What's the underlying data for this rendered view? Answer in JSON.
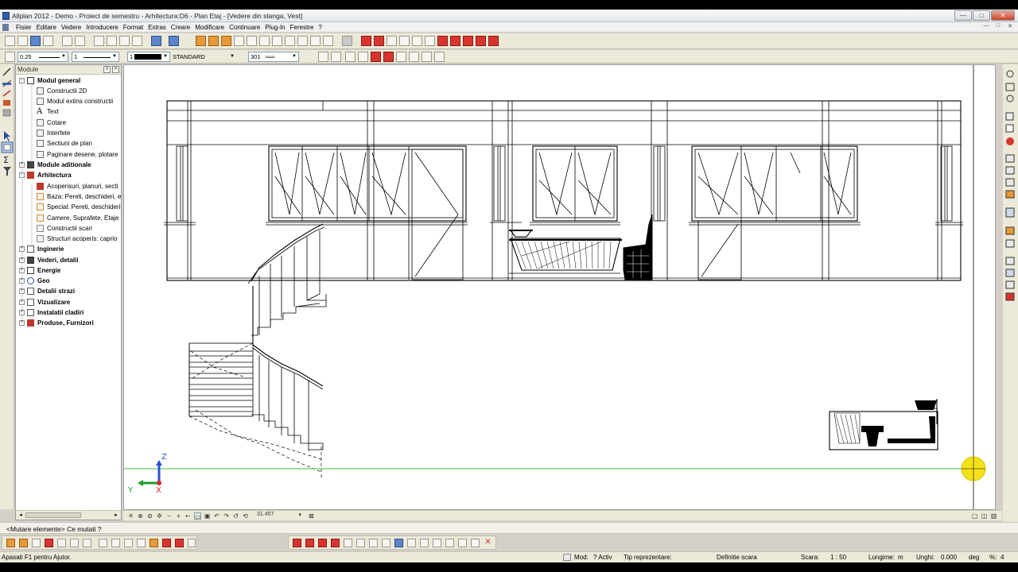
{
  "window": {
    "title": "Allplan 2012 - Demo - Proiect de semestru - Arhitectura:D6 - Plan Etaj - [Vedere din stanga, Vest]",
    "minimize": "—",
    "maximize": "□",
    "close": "✕"
  },
  "menu": {
    "items": [
      "Fisier",
      "Editare",
      "Vedere",
      "Introducere",
      "Format",
      "Extras",
      "Creare",
      "Modificare",
      "Continuare",
      "Plug-In",
      "Ferestre",
      "?"
    ],
    "mdi_min": "—",
    "mdi_restore": "□",
    "mdi_close": "✕"
  },
  "format_toolbar": {
    "pen_value": "0.25",
    "line_value": "1",
    "color_value": "1",
    "layer_value": "STANDARD",
    "hatch_value": "301"
  },
  "module_panel": {
    "title": "Module",
    "items": [
      {
        "label": "Modul general",
        "bold": true,
        "expander": "−",
        "icon": "module-general-icon"
      },
      {
        "label": "Constructii 2D",
        "bold": false,
        "icon": "construction-2d-icon"
      },
      {
        "label": "Modul extins constructii",
        "bold": false,
        "icon": "extended-construction-icon"
      },
      {
        "label": "Text",
        "bold": false,
        "icon": "text-icon",
        "glyph": "A"
      },
      {
        "label": "Cotare",
        "bold": false,
        "icon": "dimension-icon"
      },
      {
        "label": "Interfete",
        "bold": false,
        "icon": "interfaces-icon"
      },
      {
        "label": "Sectiuni de plan",
        "bold": false,
        "icon": "plan-section-icon"
      },
      {
        "label": "Paginare desene, plotare",
        "bold": false,
        "icon": "plot-layout-icon"
      },
      {
        "label": "Module aditionale",
        "bold": true,
        "expander": "+",
        "icon": "additional-modules-icon"
      },
      {
        "label": "Arhitectura",
        "bold": true,
        "expander": "−",
        "icon": "architecture-icon"
      },
      {
        "label": "Acoperisuri, planuri, secti",
        "bold": false,
        "icon": "roofs-icon"
      },
      {
        "label": "Baza: Pereti, deschideri, e",
        "bold": false,
        "icon": "walls-openings-icon"
      },
      {
        "label": "Special: Pereti, deschideri",
        "bold": false,
        "icon": "special-walls-icon"
      },
      {
        "label": "Camere, Suprafete, Etaje",
        "bold": false,
        "icon": "rooms-icon"
      },
      {
        "label": "Constructii scari",
        "bold": false,
        "icon": "stairs-icon"
      },
      {
        "label": "Structuri acoperis: caprio",
        "bold": false,
        "icon": "roof-structure-icon"
      },
      {
        "label": "Inginerie",
        "bold": true,
        "expander": "+",
        "icon": "engineering-icon"
      },
      {
        "label": "Vederi, detalii",
        "bold": true,
        "expander": "+",
        "icon": "views-details-icon"
      },
      {
        "label": "Energie",
        "bold": true,
        "expander": "+",
        "icon": "energy-icon"
      },
      {
        "label": "Geo",
        "bold": true,
        "expander": "+",
        "icon": "geo-icon"
      },
      {
        "label": "Detalii strazi",
        "bold": true,
        "expander": "+",
        "icon": "street-details-icon"
      },
      {
        "label": "Vizualizare",
        "bold": true,
        "expander": "+",
        "icon": "visualization-icon"
      },
      {
        "label": "Instalatii cladiri",
        "bold": true,
        "expander": "+",
        "icon": "building-services-icon"
      },
      {
        "label": "Produse, Furnizori",
        "bold": true,
        "expander": "+",
        "icon": "products-suppliers-icon"
      }
    ]
  },
  "canvas": {
    "axis_z": "Z",
    "axis_y": "Y",
    "axis_x": "X"
  },
  "canvas_bar": {
    "scale_value": "31.457"
  },
  "prompt": {
    "text": "<Mutare elemente> Ce mutati ?"
  },
  "status": {
    "help": "Apasati F1 pentru Ajutor.",
    "mode": "Mod:",
    "mode_value": "? Activ",
    "representation": "Tip reprezentare:",
    "scale_def": "Definitie scara",
    "scale_label": "Scara:",
    "scale_value": "1 : 50",
    "length_label": "Lungime:",
    "length_unit": "m",
    "angle_label": "Unghi:",
    "angle_value": "0.000",
    "angle_unit": "deg",
    "percent_label": "%:",
    "percent_value": "4"
  }
}
